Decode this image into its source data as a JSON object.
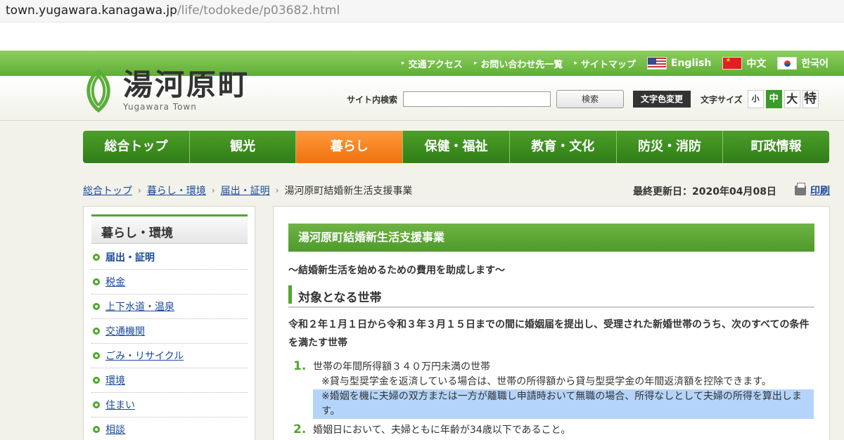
{
  "browser": {
    "url_domain": "town.yugawara.kanagawa.jp",
    "url_path": "/life/todokede/p03682.html"
  },
  "header": {
    "top_links": [
      "交通アクセス",
      "お問い合わせ先一覧",
      "サイトマップ"
    ],
    "languages": [
      {
        "label": "English",
        "flag": "us-flag-icon"
      },
      {
        "label": "中文",
        "flag": "cn-flag-icon"
      },
      {
        "label": "한국어",
        "flag": "kr-flag-icon"
      }
    ],
    "logo_jp": "湯河原町",
    "logo_en": "Yugawara Town",
    "search_label": "サイト内検索",
    "search_value": "",
    "search_button": "検索",
    "color_button": "文字色変更",
    "fontsize_label": "文字サイズ",
    "fontsizes": [
      "小",
      "中",
      "大",
      "特"
    ],
    "fontsize_selected": "中"
  },
  "nav": {
    "items": [
      "総合トップ",
      "観光",
      "暮らし",
      "保健・福祉",
      "教育・文化",
      "防災・消防",
      "町政情報"
    ],
    "active": "暮らし"
  },
  "breadcrumb": {
    "links": [
      "総合トップ",
      "暮らし・環境",
      "届出・証明"
    ],
    "current": "湯河原町結婚新生活支援事業"
  },
  "updated": "最終更新日：2020年04月08日",
  "print_label": "印刷",
  "sidebar": {
    "title": "暮らし・環境",
    "items": [
      "届出・証明",
      "税金",
      "上下水道・温泉",
      "交通機関",
      "ごみ・リサイクル",
      "環境",
      "住まい",
      "相談"
    ],
    "current": "届出・証明"
  },
  "content": {
    "title": "湯河原町結婚新生活支援事業",
    "subtitle": "〜結婚新生活を始めるための費用を助成します〜",
    "section_heading": "対象となる世帯",
    "intro": "令和２年１月１日から令和３年３月１５日までの間に婚姻届を提出し、受理された新婚世帯のうち、次のすべての条件を満たす世帯",
    "list": [
      {
        "num": "1.",
        "text": "世帯の年間所得額３４０万円未満の世帯",
        "note1": "※貸与型奨学金を返済している場合は、世帯の所得額から貸与型奨学金の年間返済額を控除できます。",
        "note2": "※婚姻を機に夫婦の双方または一方が離職し申請時おいて無職の場合、所得なしとして夫婦の所得を算出します。"
      },
      {
        "num": "2.",
        "text": "婚姻日において、夫婦ともに年齢が34歳以下であること。"
      }
    ]
  }
}
